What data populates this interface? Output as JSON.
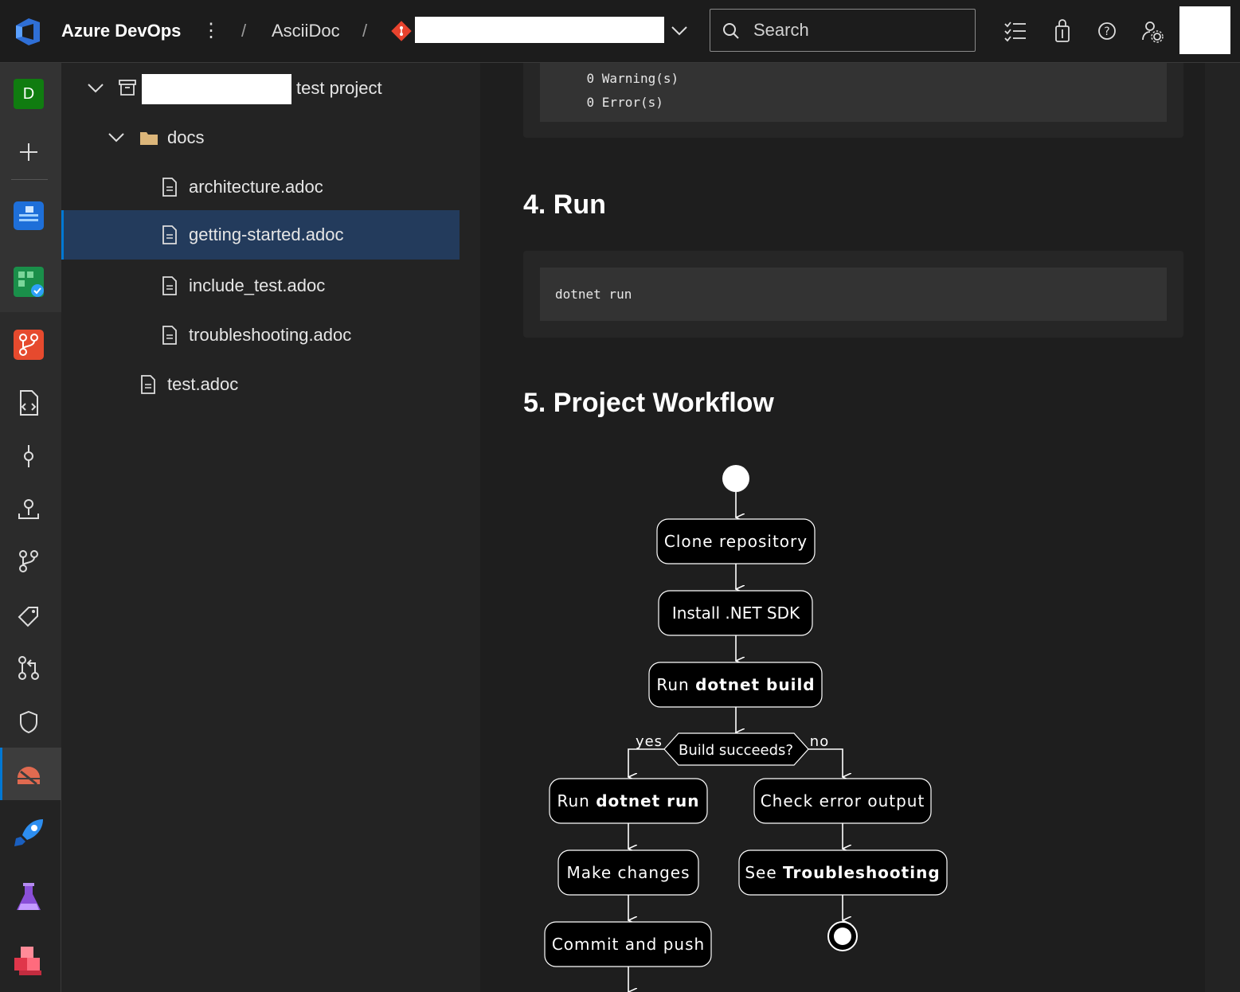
{
  "topbar": {
    "brand": "Azure DevOps",
    "breadcrumb_project": "AsciiDoc",
    "search_placeholder": "Search"
  },
  "rail": {
    "user_initial": "D"
  },
  "tree": {
    "project_suffix": "test project",
    "folder": "docs",
    "files": [
      "architecture.adoc",
      "getting-started.adoc",
      "include_test.adoc",
      "troubleshooting.adoc"
    ],
    "root_file": "test.adoc"
  },
  "content": {
    "build_output": [
      "    0 Warning(s)",
      "    0 Error(s)"
    ],
    "section4_title": "4. Run",
    "section4_code": "dotnet run",
    "section5_title": "5. Project Workflow",
    "workflow": {
      "step_clone": "Clone repository",
      "step_install": "Install .NET SDK",
      "step_build_prefix": "Run ",
      "step_build_cmd": "dotnet build",
      "decision": "Build succeeds?",
      "yes": "yes",
      "no": "no",
      "step_run_prefix": "Run ",
      "step_run_cmd": "dotnet run",
      "step_changes": "Make changes",
      "step_commit": "Commit and push",
      "step_check": "Check error output",
      "step_see_prefix": "See ",
      "step_see_target": "Troubleshooting"
    }
  },
  "colors": {
    "accent": "#0078d4",
    "selected_row": "#233b5c",
    "user_badge": "#107c10",
    "git_icon": "#e8432e",
    "folder": "#dcb67a"
  }
}
